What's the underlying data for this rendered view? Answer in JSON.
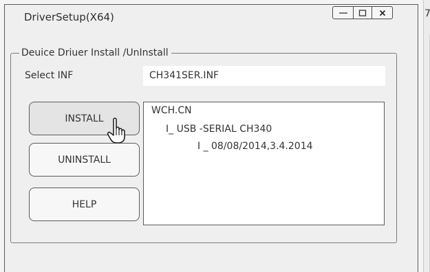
{
  "window": {
    "title": "DriverSetup(X64)",
    "controls": {
      "minimize_icon": "minimize-icon",
      "maximize_icon": "maximize-icon",
      "close_icon": "close-icon"
    }
  },
  "group": {
    "legend": "Deuice Driuer  Install /UnInstall",
    "select_label": "Select INF",
    "inf_value": "CH341SER.INF"
  },
  "buttons": {
    "install": "INSTALL",
    "uninstall": "UNINSTALL",
    "help": "HELP"
  },
  "info": {
    "lines": [
      "WCH.CN",
      "I_ USB -SERIAL CH340",
      "I _ 08/08/2014,3.4.2014"
    ]
  },
  "edge": {
    "glyph": "7"
  },
  "cursor_icon": "hand-pointer-icon"
}
